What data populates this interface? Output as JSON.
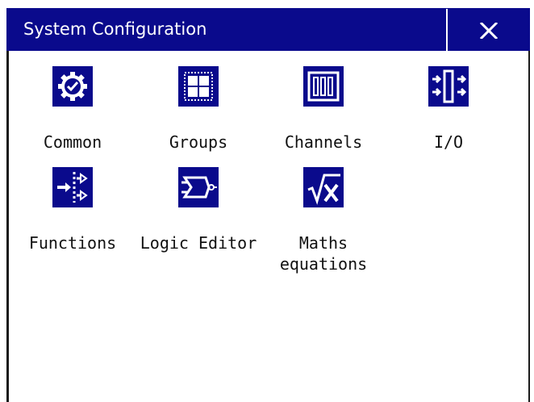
{
  "window": {
    "title": "System Configuration",
    "close_label": "×"
  },
  "colors": {
    "accent": "#0a0a8c",
    "icon_fg": "#ffffff",
    "text": "#111111"
  },
  "tiles": [
    {
      "label": "Common",
      "icon": "gear-check-icon"
    },
    {
      "label": "Groups",
      "icon": "grid-icon"
    },
    {
      "label": "Channels",
      "icon": "channel-bars-icon"
    },
    {
      "label": "I/O",
      "icon": "io-arrows-icon"
    },
    {
      "label": "Functions",
      "icon": "function-branch-icon"
    },
    {
      "label": "Logic Editor",
      "icon": "logic-gate-icon"
    },
    {
      "label": "Maths\nequations",
      "icon": "square-root-icon"
    }
  ]
}
